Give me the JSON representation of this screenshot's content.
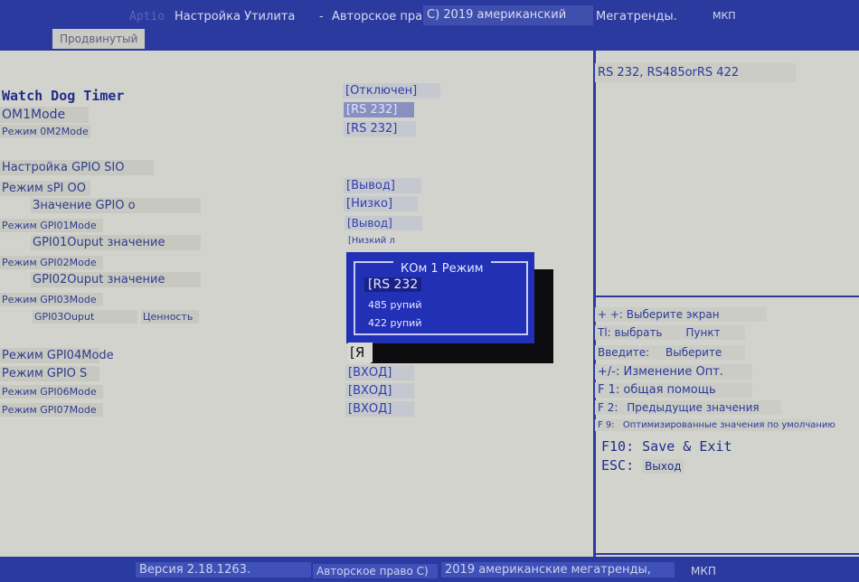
{
  "header": {
    "partial_brand": "Aptio",
    "title": "Настройка  Утилита",
    "dash": "-",
    "copyright_label": "Авторское право",
    "copyright_year": "С) 2019 американский",
    "vendor": "Мегатренды.",
    "mkp": "МКП"
  },
  "tabs": [
    {
      "label": "Продвинутый"
    }
  ],
  "settings": [
    {
      "label": "Watch Dog Timer",
      "value": "[Отключен]"
    },
    {
      "label": "OM1Mode",
      "value": "[RS 232]"
    },
    {
      "label": "Режим 0M2Mode",
      "value": "[RS 232]"
    },
    {
      "label": "Настройка GPIO SIO",
      "value": ""
    },
    {
      "label": "Режим sPI OO",
      "value": "[Вывод]"
    },
    {
      "label": "Значение GPIO о",
      "value": "[Низко]"
    },
    {
      "label": "Режим GPI01Mode",
      "value": "[Вывод]"
    },
    {
      "label": "GPI01Ouput значение",
      "value": "[Низкий л"
    },
    {
      "label": "Режим GPI02Mode",
      "value": ""
    },
    {
      "label": "GPI02Ouput значение",
      "value": ""
    },
    {
      "label": "Режим GPI03Mode",
      "value": ""
    },
    {
      "label": "GPI03Ouput",
      "label2": "Ценность",
      "value": ""
    },
    {
      "label": "Режим GPI04Mode",
      "value": "[Я"
    },
    {
      "label": "Режим GPIO S",
      "value": "[ВХОД]"
    },
    {
      "label": "Режим GPI06Mode",
      "value": "[ВХОД]"
    },
    {
      "label": "Режим GPI07Mode",
      "value": "[ВХОД]"
    }
  ],
  "popup": {
    "title": "КОм 1  Режим",
    "options": [
      "[RS 232",
      "485 рупий",
      "422 рупий"
    ],
    "selected_index": 0
  },
  "help_panel": {
    "description": "RS 232, RS485orRS 422",
    "keys": [
      {
        "key": "+ +:",
        "desc": "Выберите экран"
      },
      {
        "key": "Tl: выбрать",
        "desc": "Пункт"
      },
      {
        "key": "Введите:",
        "desc": "Выберите"
      },
      {
        "key": "+/-:",
        "desc": "Изменение Опт."
      },
      {
        "key": "F 1:",
        "desc": "общая помощь"
      },
      {
        "key": "F 2:",
        "desc": "Предыдущие значения"
      },
      {
        "key": "F 9:",
        "desc": "Оптимизированные значения по умолчанию"
      },
      {
        "key": "F10:",
        "desc": "Save & Exit"
      },
      {
        "key": "ESC:",
        "desc": "Выход"
      }
    ]
  },
  "footer": {
    "version": "Версия 2.18.1263.",
    "copyright_label": "Авторское право  С)",
    "copyright_text": "2019 американские мегатренды,",
    "mkp": "МКП"
  },
  "colors": {
    "bios_blue": "#2b3a9e",
    "background": "#d2d3cd",
    "popup_blue": "#2130b4"
  }
}
